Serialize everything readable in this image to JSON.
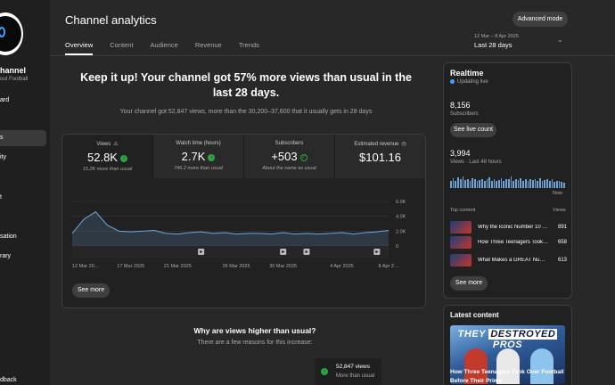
{
  "sidebar": {
    "channel_name": "hannel",
    "channel_sub": "out Football",
    "items": [
      {
        "label": "ard",
        "active": false
      },
      {
        "label": "s",
        "active": true
      },
      {
        "label": "ity",
        "active": false
      },
      {
        "label": "t",
        "active": false
      },
      {
        "label": "sation",
        "active": false
      },
      {
        "label": "rary",
        "active": false
      },
      {
        "label": "dback",
        "active": false
      }
    ]
  },
  "header": {
    "title": "Channel analytics",
    "tabs": [
      "Overview",
      "Content",
      "Audience",
      "Revenue",
      "Trends"
    ],
    "active_tab": "Overview",
    "advanced_mode_label": "Advanced mode",
    "date_range": "12 Mar – 8 Apr 2025",
    "date_label": "Last 28 days"
  },
  "summary": {
    "headline": "Keep it up! Your channel got 57% more views than usual in the last 28 days.",
    "subline": "Your channel got 52,847 views, more than the 30,200–37,600 that it usually gets in 28 days"
  },
  "metrics": [
    {
      "label": "Views",
      "value": "52.8K",
      "note": "15.2K more than usual",
      "badge": "up",
      "flag": "⚠"
    },
    {
      "label": "Watch time (hours)",
      "value": "2.7K",
      "note": "746.2 more than usual",
      "badge": "up",
      "flag": ""
    },
    {
      "label": "Subscribers",
      "value": "+503",
      "note": "About the same as usual",
      "badge": "check",
      "flag": ""
    },
    {
      "label": "Estimated revenue",
      "value": "$101.16",
      "note": "",
      "badge": "",
      "flag": "◷"
    }
  ],
  "chart_data": {
    "type": "area",
    "x": [
      "12 Mar",
      "13 Mar",
      "14 Mar",
      "15 Mar",
      "16 Mar",
      "17 Mar",
      "18 Mar",
      "19 Mar",
      "20 Mar",
      "21 Mar",
      "22 Mar",
      "23 Mar",
      "24 Mar",
      "25 Mar",
      "26 Mar",
      "27 Mar",
      "28 Mar",
      "29 Mar",
      "30 Mar",
      "31 Mar",
      "1 Apr",
      "2 Apr",
      "3 Apr",
      "4 Apr",
      "5 Apr",
      "6 Apr",
      "7 Apr",
      "8 Apr"
    ],
    "values": [
      1700,
      3600,
      4600,
      2800,
      2000,
      1900,
      2000,
      2100,
      1700,
      1600,
      1800,
      1900,
      1700,
      1800,
      1600,
      1700,
      1700,
      1600,
      1800,
      1600,
      1700,
      1600,
      1700,
      1800,
      1600,
      1800,
      1900,
      2100
    ],
    "x_tick_labels": [
      "12 Mar 20…",
      "17 Mar 2025",
      "21 Mar 2025",
      "26 Mar 2025",
      "30 Mar 2025",
      "4 Apr 2025",
      "8 Apr 2…"
    ],
    "y_tick_labels": [
      "6.0K",
      "4.0K",
      "2.0K",
      "0"
    ],
    "ylim": [
      0,
      6000
    ],
    "grid": true,
    "series_color": "#6fa8dc",
    "marker_days": [
      "23 Mar",
      "30 Mar",
      "1 Apr",
      "7 Apr"
    ],
    "marker_icon": "play-icon"
  },
  "chart_see_more": "See more",
  "why": {
    "title": "Why are views higher than usual?",
    "sub": "There are a few reasons for this increase:",
    "reason_value": "52,847 views",
    "reason_note": "More than usual"
  },
  "realtime": {
    "title": "Realtime",
    "live_label": "Updating live",
    "subs_value": "8,156",
    "subs_label": "Subscribers",
    "live_count_btn": "See live count",
    "views_value": "3,994",
    "views_label": "Views · Last 48 hours",
    "bars": [
      0.55,
      0.8,
      0.6,
      0.85,
      0.7,
      0.9,
      0.65,
      0.75,
      0.6,
      0.8,
      0.7,
      0.55,
      0.65,
      0.75,
      0.6,
      0.7,
      0.85,
      0.6,
      0.7,
      0.55,
      0.65,
      0.8,
      0.6,
      0.7,
      0.75,
      0.9,
      0.6,
      0.7,
      0.65,
      0.8,
      0.55,
      0.7,
      0.6,
      0.75,
      0.65,
      0.7,
      0.6,
      0.8,
      0.55,
      0.65,
      0.7,
      0.6,
      0.75,
      0.5,
      0.6,
      0.55,
      0.5,
      0.4
    ],
    "now_label": "Now",
    "top_content_label": "Top content",
    "views_col_label": "Views",
    "top_content": [
      {
        "title": "Why the Iconic Number 10 …",
        "views": "891"
      },
      {
        "title": "How Three Teenagers Took…",
        "views": "658"
      },
      {
        "title": "What Makes a GREAT Num…",
        "views": "613"
      }
    ],
    "see_more": "See more"
  },
  "latest": {
    "title": "Latest content",
    "thumb_text_a": "THEY",
    "thumb_text_b": "DESTROYED",
    "thumb_text_c": "PROS",
    "caption": "How Three Teenagers Took Over Football Before Their Prime"
  }
}
